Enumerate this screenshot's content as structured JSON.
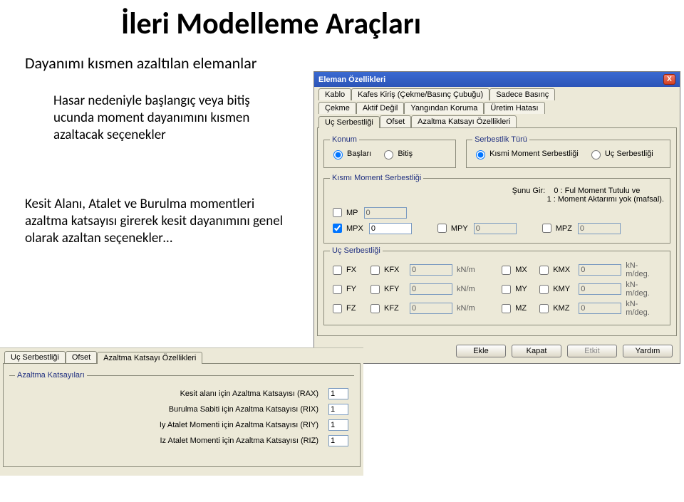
{
  "slide": {
    "title": "İleri Modelleme Araçları",
    "subtitle": "Dayanımı kısmen azaltılan elemanlar",
    "para1": "Hasar nedeniyle başlangıç veya bitiş ucunda moment dayanımını kısmen azaltacak seçenekler",
    "para2": "Kesit Alanı, Atalet ve Burulma momentleri azaltma katsayısı girerek kesit dayanımını genel olarak azaltan seçenekler…"
  },
  "dialog1": {
    "title": "Eleman Özellikleri",
    "close": "X",
    "tabs_row1": [
      "Kablo",
      "Kafes Kiriş (Çekme/Basınç Çubuğu)",
      "Sadece Basınç"
    ],
    "tabs_row2": [
      "Çekme",
      "Aktif Değil",
      "Yangından Koruma",
      "Üretim Hatası"
    ],
    "tabs_row3": [
      "Uç Serbestliği",
      "Ofset",
      "Azaltma Katsayı Özellikleri"
    ],
    "konum": {
      "legend": "Konum",
      "baslari": "Başları",
      "bitis": "Bitiş"
    },
    "serbestlik_turu": {
      "legend": "Serbestlik Türü",
      "kismi": "Kısmi Moment Serbestliği",
      "uc": "Uç Serbestliği"
    },
    "kms": {
      "legend": "Kısmı Moment Serbestliği",
      "sunu_gir": "Şunu Gir:",
      "hint0": "0 : Ful Moment Tutulu ve",
      "hint1": "1 : Moment Aktarımı yok (mafsal).",
      "mp_label": "MP",
      "mpx_label": "MPX",
      "mpy_label": "MPY",
      "mpz_label": "MPZ",
      "mp_val": "0",
      "mpx_val": "0",
      "mpy_val": "0",
      "mpz_val": "0",
      "mp_checked": false,
      "mpx_checked": true,
      "mpy_checked": false,
      "mpz_checked": false
    },
    "uc": {
      "legend": "Uç Serbestliği",
      "rows": [
        {
          "f": "FX",
          "kf": "KFX",
          "fval": "0",
          "u1": "kN/m",
          "m": "MX",
          "km": "KMX",
          "mval": "0",
          "u2": "kN-m/deg."
        },
        {
          "f": "FY",
          "kf": "KFY",
          "fval": "0",
          "u1": "kN/m",
          "m": "MY",
          "km": "KMY",
          "mval": "0",
          "u2": "kN-m/deg."
        },
        {
          "f": "FZ",
          "kf": "KFZ",
          "fval": "0",
          "u1": "kN/m",
          "m": "MZ",
          "km": "KMZ",
          "mval": "0",
          "u2": "kN-m/deg."
        }
      ]
    },
    "buttons": {
      "ekle": "Ekle",
      "kapat": "Kapat",
      "etkit": "Etkit",
      "yardim": "Yardım"
    }
  },
  "dialog2": {
    "tabs": [
      "Uç Serbestliği",
      "Ofset",
      "Azaltma Katsayı Özellikleri"
    ],
    "legend": "Azaltma Katsayıları",
    "factors": [
      {
        "label": "Kesit alanı için Azaltma Katsayısı (RAX)",
        "val": "1"
      },
      {
        "label": "Burulma Sabiti için Azaltma Katsayısı (RIX)",
        "val": "1"
      },
      {
        "label": "Iy Atalet Momenti için Azaltma Katsayısı (RIY)",
        "val": "1"
      },
      {
        "label": "Iz Atalet Momenti için Azaltma Katsayısı (RIZ)",
        "val": "1"
      }
    ]
  }
}
